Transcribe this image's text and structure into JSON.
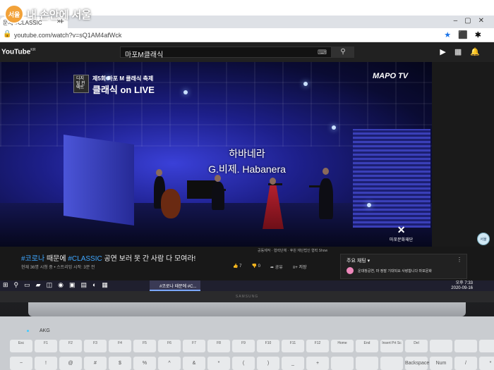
{
  "watermark": {
    "logo": "서울",
    "text": "내 손안에 서울"
  },
  "browser": {
    "tab_title": "문제 #CLASSIC",
    "url": "youtube.com/watch?v=sQ1AM4afWck"
  },
  "youtube": {
    "logo": "YouTube",
    "region": "KR",
    "search_value": "마포M클래식"
  },
  "video": {
    "badge_box": "디지털 컨택트",
    "badge_subtitle": "제5회 마포 M 클래식 축제",
    "badge_title": "클래식 on LIVE",
    "channel_logo": "MAPO TV",
    "caption_line1": "하바네라",
    "caption_line2": "G.비제. Habanera",
    "org_logo": "마포문화재단"
  },
  "info": {
    "credits": "공동제작 · 협력단체 · 후원 재단법인 협력 Show",
    "title_tag1": "#코로나",
    "title_mid": " 때문에 ",
    "title_tag2": "#CLASSIC",
    "title_rest": " 공연 보러 못 간 사람 다 모여라!",
    "meta": "현재 36명 시청 중 • 스트리밍 시작: 3분 전",
    "like_count": "7",
    "dislike_count": "0",
    "share_label": "공유",
    "save_label": "저장"
  },
  "chat": {
    "header": "주요 채팅",
    "message": "운대창공연, 마 정말 기대되요 사랑합니다 마포문화"
  },
  "sidebar": {
    "avatar_text": "서울"
  },
  "taskbar": {
    "active_window": "#코로나 때문에 #C...",
    "time": "오후 7:33",
    "date": "2020-09-16"
  },
  "laptop": {
    "brand": "SAMSUNG",
    "speaker": "AKG",
    "fkeys": [
      "Esc",
      "F1",
      "F2",
      "F3",
      "F4",
      "F5",
      "F6",
      "F7",
      "F8",
      "F9",
      "F10",
      "F11",
      "F12",
      "Home",
      "End",
      "Insert Prt Sc",
      "Del",
      "",
      "",
      ""
    ],
    "numrow": [
      "~",
      "!",
      "@",
      "#",
      "$",
      "%",
      "^",
      "&",
      "*",
      "(",
      ")",
      "_",
      "+",
      "",
      "",
      "",
      "Backspace",
      "Num",
      "/",
      "*"
    ]
  }
}
